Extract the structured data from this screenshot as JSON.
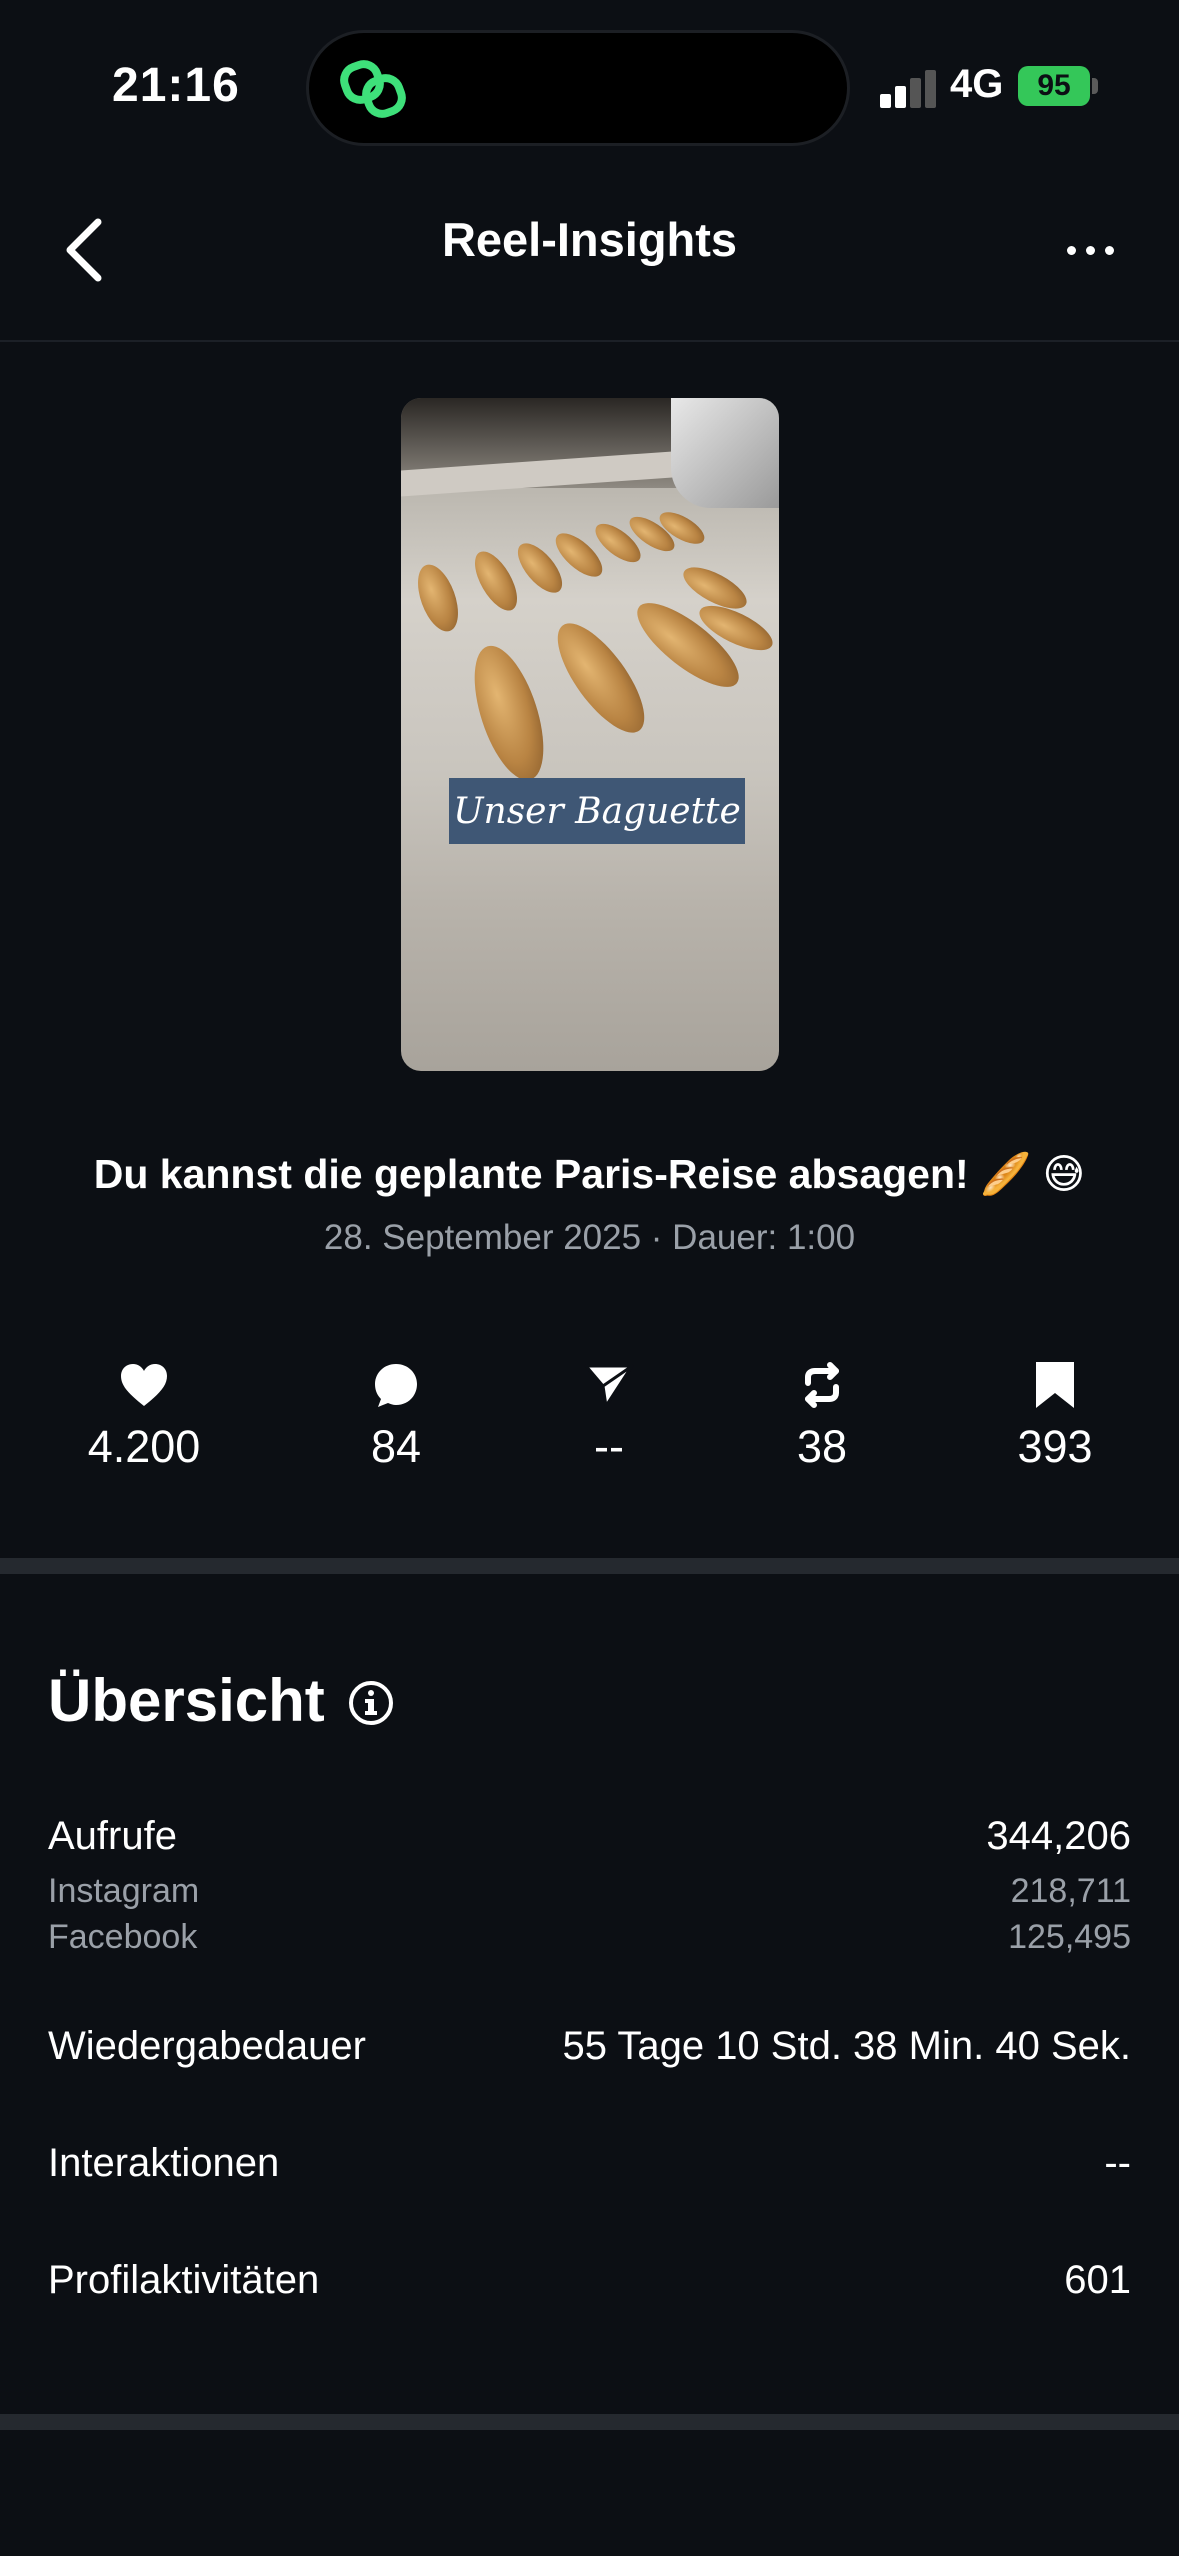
{
  "status_bar": {
    "time": "21:16",
    "network": "4G",
    "battery": "95"
  },
  "nav": {
    "title": "Reel-Insights"
  },
  "reel": {
    "thumbnail_caption": "Unser Baguette",
    "title": "Du kannst die geplante Paris-Reise absagen! 🥖 😅",
    "meta": "28. September 2025 · Dauer: 1:00"
  },
  "stats": {
    "likes": "4.200",
    "comments": "84",
    "shares": "--",
    "reposts": "38",
    "saves": "393"
  },
  "overview": {
    "title": "Übersicht",
    "views_label": "Aufrufe",
    "views_value": "344,206",
    "instagram_label": "Instagram",
    "instagram_value": "218,711",
    "facebook_label": "Facebook",
    "facebook_value": "125,495",
    "watch_time_label": "Wiedergabedauer",
    "watch_time_value": "55 Tage 10 Std. 38 Min. 40 Sek.",
    "interactions_label": "Interaktionen",
    "interactions_value": "--",
    "profile_activity_label": "Profilaktivitäten",
    "profile_activity_value": "601"
  },
  "icons": {
    "accent_green": "#34c759",
    "link_icon_color": "#3ee07a"
  }
}
